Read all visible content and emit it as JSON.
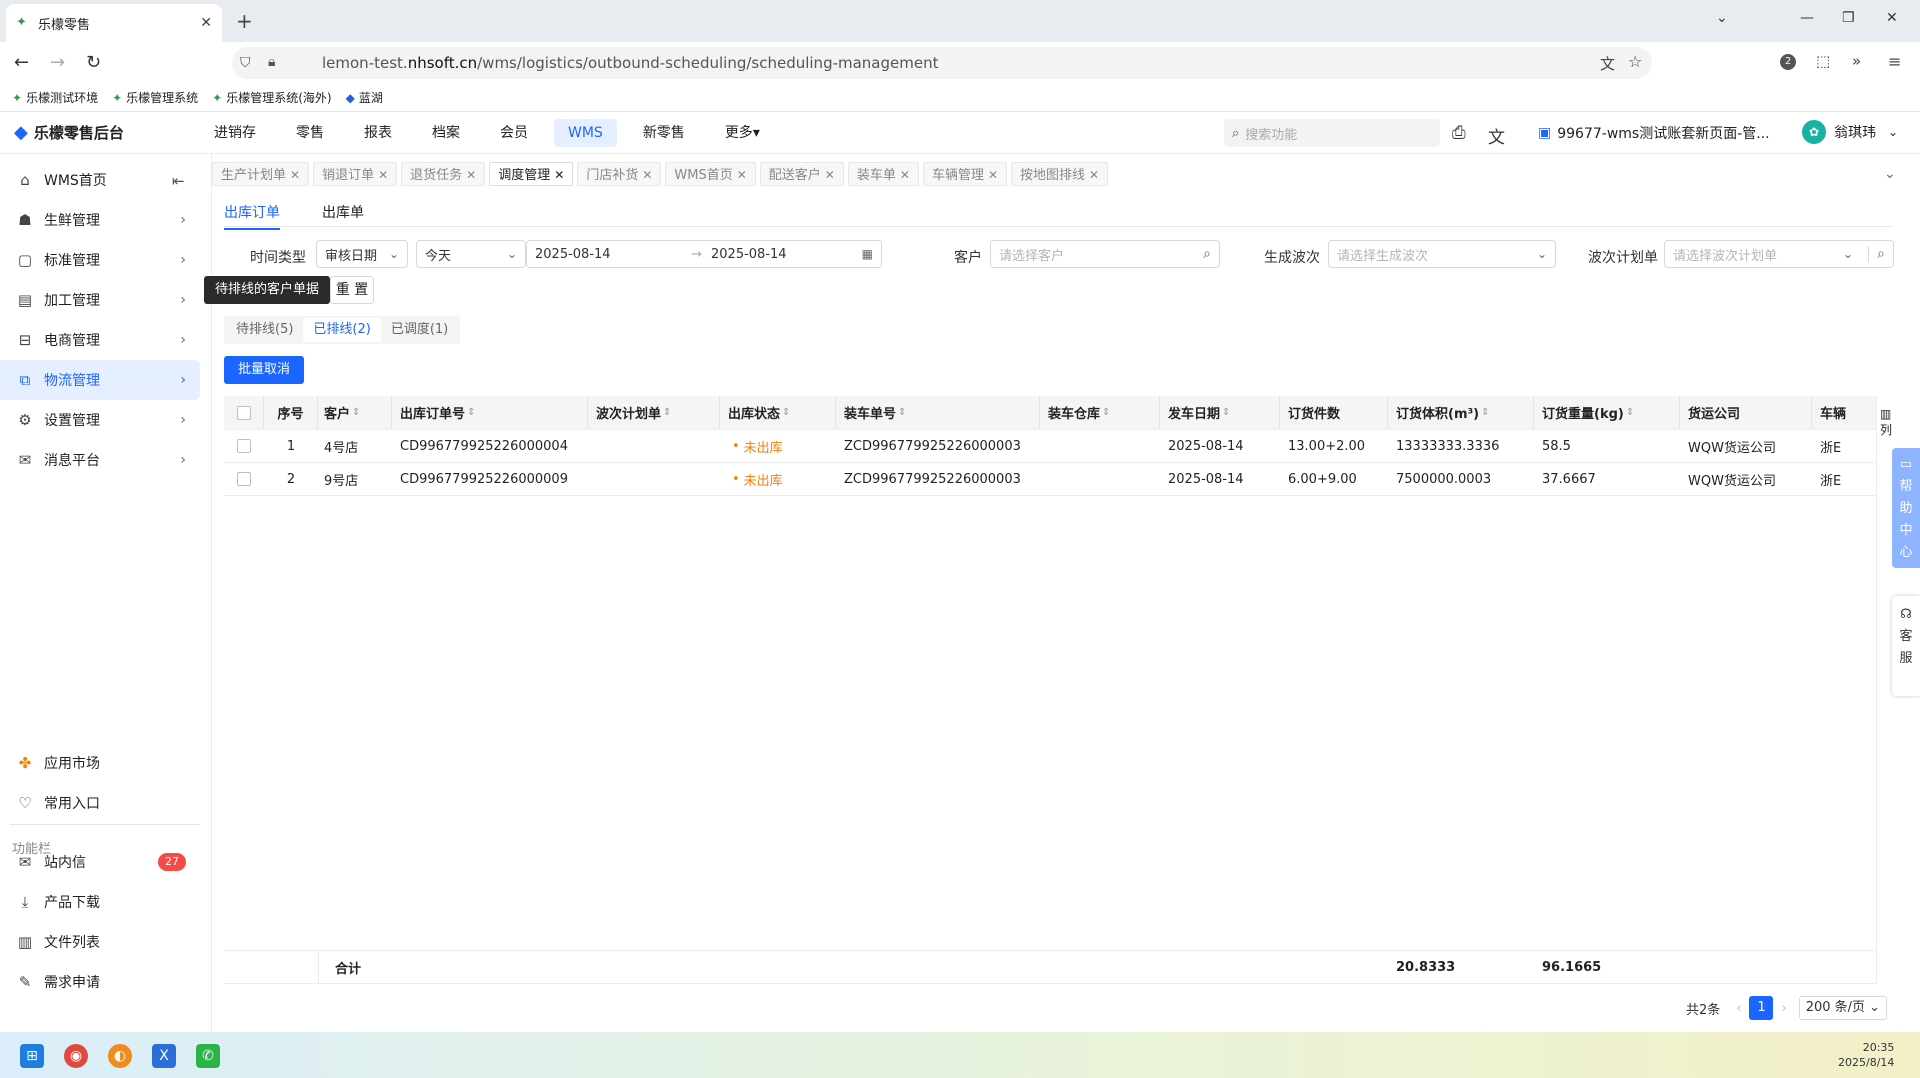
{
  "browser": {
    "tab_title": "乐檬零售",
    "url_prefix": "lemon-test.",
    "url_domain": "nhsoft.cn",
    "url_path": "/wms/logistics/outbound-scheduling/scheduling-management",
    "bookmarks": [
      "乐檬测试环境",
      "乐檬管理系统",
      "乐檬管理系统(海外)",
      "蓝湖"
    ],
    "ext_badge": "2"
  },
  "header": {
    "logo": "乐檬零售后台",
    "nav": [
      "进销存",
      "零售",
      "报表",
      "档案",
      "会员",
      "WMS",
      "新零售",
      "更多"
    ],
    "active_nav": "WMS",
    "search_placeholder": "搜索功能",
    "account": "99677-wms测试账套新页面-管...",
    "user": "翁琪玮"
  },
  "sidebar": {
    "items": [
      {
        "label": "WMS首页",
        "icon": "home-icon"
      },
      {
        "label": "生鲜管理",
        "icon": "fresh-icon"
      },
      {
        "label": "标准管理",
        "icon": "standard-icon"
      },
      {
        "label": "加工管理",
        "icon": "process-icon"
      },
      {
        "label": "电商管理",
        "icon": "shop-icon"
      },
      {
        "label": "物流管理",
        "icon": "logistics-icon"
      },
      {
        "label": "设置管理",
        "icon": "settings-icon"
      },
      {
        "label": "消息平台",
        "icon": "message-icon"
      }
    ],
    "bottom": [
      {
        "label": "应用市场",
        "icon": "app-market-icon"
      },
      {
        "label": "常用入口",
        "icon": "heart-icon"
      }
    ],
    "func_label": "功能栏",
    "func_items": [
      {
        "label": "站内信",
        "icon": "mail-icon",
        "badge": "27"
      },
      {
        "label": "产品下载",
        "icon": "download-icon"
      },
      {
        "label": "文件列表",
        "icon": "file-list-icon"
      },
      {
        "label": "需求申请",
        "icon": "request-icon"
      }
    ]
  },
  "page_tabs": [
    "生产计划单",
    "销退订单",
    "退货任务",
    "调度管理",
    "门店补货",
    "WMS首页",
    "配送客户",
    "装车单",
    "车辆管理",
    "按地图排线"
  ],
  "active_page_tab": "调度管理",
  "sub_tabs": [
    "出库订单",
    "出库单"
  ],
  "filters": {
    "time_type_label": "时间类型",
    "time_type_value": "审核日期",
    "period_value": "今天",
    "date_from": "2025-08-14",
    "date_to": "2025-08-14",
    "customer_label": "客户",
    "customer_placeholder": "请选择客户",
    "wave_label": "生成波次",
    "wave_placeholder": "请选择生成波次",
    "plan_label": "波次计划单",
    "plan_placeholder": "请选择波次计划单",
    "reset": "重 置",
    "tooltip": "待排线的客户单据"
  },
  "status_tabs": [
    "待排线(5)",
    "已排线(2)",
    "已调度(1)"
  ],
  "batch_cancel": "批量取消",
  "table": {
    "columns": [
      "序号",
      "客户",
      "出库订单号",
      "波次计划单",
      "出库状态",
      "装车单号",
      "装车仓库",
      "发车日期",
      "订货件数",
      "订货体积(m³)",
      "订货重量(kg)",
      "货运公司",
      "车辆"
    ],
    "rows": [
      {
        "no": "1",
        "customer": "4号店",
        "order": "CD996779925226000004",
        "wave": "",
        "status": "未出库",
        "load_no": "ZCD996779925226000003",
        "warehouse": "",
        "date": "2025-08-14",
        "qty": "13.00+2.00",
        "volume": "13333333.3336",
        "weight": "58.5",
        "carrier": "WQW货运公司",
        "vehicle": "浙E"
      },
      {
        "no": "2",
        "customer": "9号店",
        "order": "CD996779925226000009",
        "wave": "",
        "status": "未出库",
        "load_no": "ZCD996779925226000003",
        "warehouse": "",
        "date": "2025-08-14",
        "qty": "6.00+9.00",
        "volume": "7500000.0003",
        "weight": "37.6667",
        "carrier": "WQW货运公司",
        "vehicle": "浙E"
      }
    ],
    "total_label": "合计",
    "total_volume": "20.8333",
    "total_weight": "96.1665",
    "columns_btn": "列"
  },
  "pager": {
    "total": "共2条",
    "page": "1",
    "page_size": "200 条/页"
  },
  "float": {
    "help": [
      "帮",
      "助",
      "中",
      "心"
    ],
    "service": [
      "客",
      "服"
    ]
  },
  "clock": {
    "time": "20:35",
    "date": "2025/8/14"
  }
}
